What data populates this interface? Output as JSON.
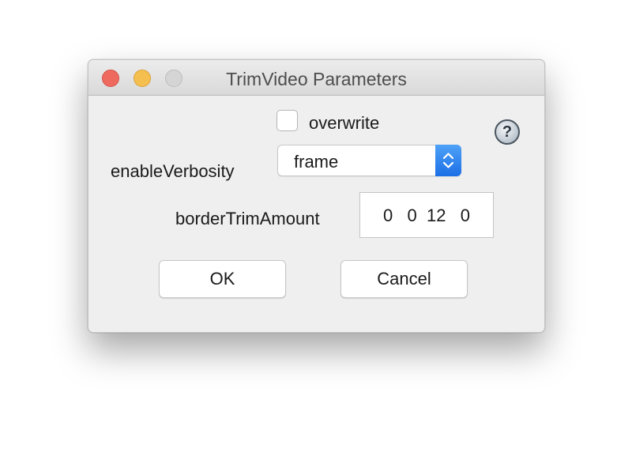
{
  "window": {
    "title": "TrimVideo Parameters"
  },
  "params": {
    "overwrite_label": "overwrite",
    "overwrite_checked": false,
    "verbosity_label": "enableVerbosity",
    "verbosity_value": "frame",
    "border_label": "borderTrimAmount",
    "border_value": "0   0  12   0"
  },
  "help": {
    "glyph": "?",
    "icon": "help-icon"
  },
  "buttons": {
    "ok": "OK",
    "cancel": "Cancel"
  },
  "colors": {
    "close": "#ee6a5f",
    "minimize": "#f5bf4f",
    "maximize": "#d5d5d5",
    "accent": "#1d6fe6"
  }
}
